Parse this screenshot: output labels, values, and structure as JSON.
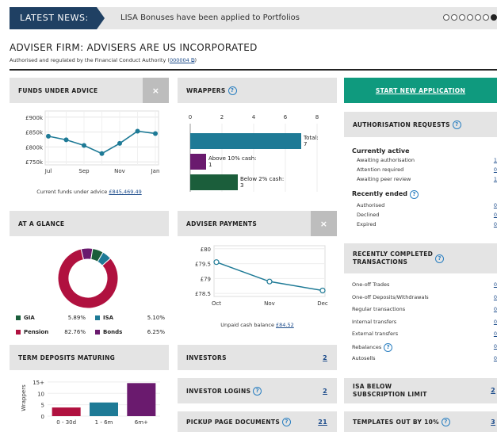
{
  "news": {
    "label": "LATEST NEWS:",
    "text": "LISA Bonuses have been applied to Portfolios",
    "dots": [
      false,
      false,
      false,
      false,
      false,
      false,
      true
    ]
  },
  "firm": {
    "title": "ADVISER FIRM: ADVISERS ARE US INCORPORATED",
    "auth_prefix": "Authorised and regulated by the Financial Conduct Authority (",
    "fca": "000004",
    "auth_suffix": ")"
  },
  "funds": {
    "title": "FUNDS UNDER ADVICE",
    "close": "×",
    "footer_label": "Current funds under advice ",
    "footer_value": "£845,469.49"
  },
  "wrappers": {
    "title": "WRAPPERS"
  },
  "glance": {
    "title": "AT A GLANCE"
  },
  "payments": {
    "title": "ADVISER PAYMENTS",
    "close": "×",
    "footer_label": "Unpaid cash balance ",
    "footer_value": "£84.52"
  },
  "term": {
    "title": "TERM DEPOSITS MATURING"
  },
  "start": {
    "label": "START NEW APPLICATION"
  },
  "authreq": {
    "title": "AUTHORISATION REQUESTS",
    "active_title": "Currently active",
    "active": [
      {
        "label": "Awaiting authorisation",
        "value": "1"
      },
      {
        "label": "Attention required",
        "value": "0"
      },
      {
        "label": "Awaiting peer review",
        "value": "1"
      }
    ],
    "ended_title": "Recently ended",
    "ended": [
      {
        "label": "Authorised",
        "value": "0"
      },
      {
        "label": "Declined",
        "value": "0"
      },
      {
        "label": "Expired",
        "value": "0"
      }
    ]
  },
  "recent": {
    "title1": "RECENTLY COMPLETED",
    "title2": "TRANSACTIONS",
    "rows": [
      {
        "label": "One-off Trades",
        "value": "0"
      },
      {
        "label": "One-off Deposits/Withdrawals",
        "value": "0"
      },
      {
        "label": "Regular transactions",
        "value": "0"
      },
      {
        "label": "Internal transfers",
        "value": "0"
      },
      {
        "label": "External transfers",
        "value": "0"
      },
      {
        "label": "Rebalances",
        "value": "0"
      },
      {
        "label": "Autosells",
        "value": "0"
      }
    ]
  },
  "investors": {
    "label": "INVESTORS",
    "value": "2"
  },
  "logins": {
    "label": "INVESTOR LOGINS",
    "value": "2"
  },
  "pickup": {
    "label": "PICKUP PAGE DOCUMENTS",
    "value": "21"
  },
  "isa": {
    "label1": "ISA BELOW",
    "label2": "SUBSCRIPTION LIMIT",
    "value": "2"
  },
  "templates": {
    "label": "TEMPLATES OUT BY 10%",
    "value": "3"
  },
  "colors": {
    "navy": "#1f4063",
    "teal": "#1e7a96",
    "green": "#0f9a7e",
    "crimson": "#b0113f",
    "purple": "#6a1a6e",
    "darkgreen": "#1b5e3b"
  },
  "chart_data": [
    {
      "type": "line",
      "title": "",
      "categories": [
        "Jul",
        "Aug",
        "Sep",
        "Oct",
        "Nov",
        "Dec",
        "Jan"
      ],
      "x_ticks": [
        "Jul",
        "Sep",
        "Nov",
        "Jan"
      ],
      "y_ticks": [
        "£900k",
        "£850k",
        "£800k",
        "£750k"
      ],
      "values": [
        836,
        824,
        805,
        778,
        812,
        853,
        845
      ],
      "ylim": [
        740,
        910
      ],
      "ylabel": "",
      "xlabel": ""
    },
    {
      "type": "bar",
      "orientation": "horizontal",
      "x_ticks": [
        "0",
        "2",
        "4",
        "6",
        "8"
      ],
      "xlim": [
        0,
        8
      ],
      "categories": [
        "Total",
        "Above 10% cash",
        "Below 2% cash"
      ],
      "labels": [
        "Total:",
        "Above 10% cash:",
        "Below 2% cash:"
      ],
      "values": [
        7,
        1,
        3
      ]
    },
    {
      "type": "pie",
      "donut": true,
      "labels": [
        "GIA",
        "ISA",
        "Pension",
        "Bonds"
      ],
      "values": [
        5.89,
        5.1,
        82.76,
        6.25
      ],
      "value_labels": [
        "5.89%",
        "5.10%",
        "82.76%",
        "6.25%"
      ]
    },
    {
      "type": "line",
      "categories": [
        "Oct",
        "Nov",
        "Dec"
      ],
      "values": [
        79.55,
        78.9,
        78.6
      ],
      "y_ticks": [
        "£80",
        "£79.5",
        "£79",
        "£78.5"
      ],
      "ylim": [
        78.4,
        80.1
      ]
    },
    {
      "type": "bar",
      "categories": [
        "0 - 30d",
        "1 - 6m",
        "6m+"
      ],
      "values": [
        3.8,
        6,
        14.5
      ],
      "ylabel": "Wrappers",
      "y_ticks": [
        "15+",
        "10",
        "5",
        "0"
      ],
      "ylim": [
        0,
        16
      ]
    }
  ]
}
